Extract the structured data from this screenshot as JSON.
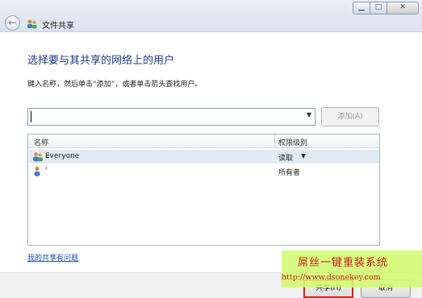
{
  "window": {
    "title": "文件共享",
    "controls": {
      "minimize": "▁",
      "maximize": "□",
      "close": "✕"
    }
  },
  "main": {
    "heading": "选择要与其共享的网络上的用户",
    "instruction": "键入名称，然后单击“添加”，或者单击箭头查找用户。",
    "name_input": {
      "value": "",
      "placeholder": ""
    },
    "add_button": "添加(A)"
  },
  "table": {
    "columns": [
      "名称",
      "权限级别"
    ],
    "rows": [
      {
        "name": "Everyone",
        "permission": "读取",
        "icon": "group-icon",
        "has_dropdown": true,
        "selected": true
      },
      {
        "name": "'",
        "permission": "所有者",
        "icon": "user-icon",
        "has_dropdown": false,
        "selected": false
      }
    ]
  },
  "help_link": "我的共享有问题",
  "footer": {
    "share_button": "共享(H)",
    "cancel_button": "取消"
  },
  "watermark": {
    "line1": "屌丝一键重装系统",
    "line2": "http://www.dsonekey.com"
  },
  "colors": {
    "heading": "#1d3d8f",
    "link": "#1a52b8",
    "highlight_border": "#d81e1e",
    "watermark_bg": "#d2fa6e",
    "watermark_text": "#cc1f1f"
  }
}
